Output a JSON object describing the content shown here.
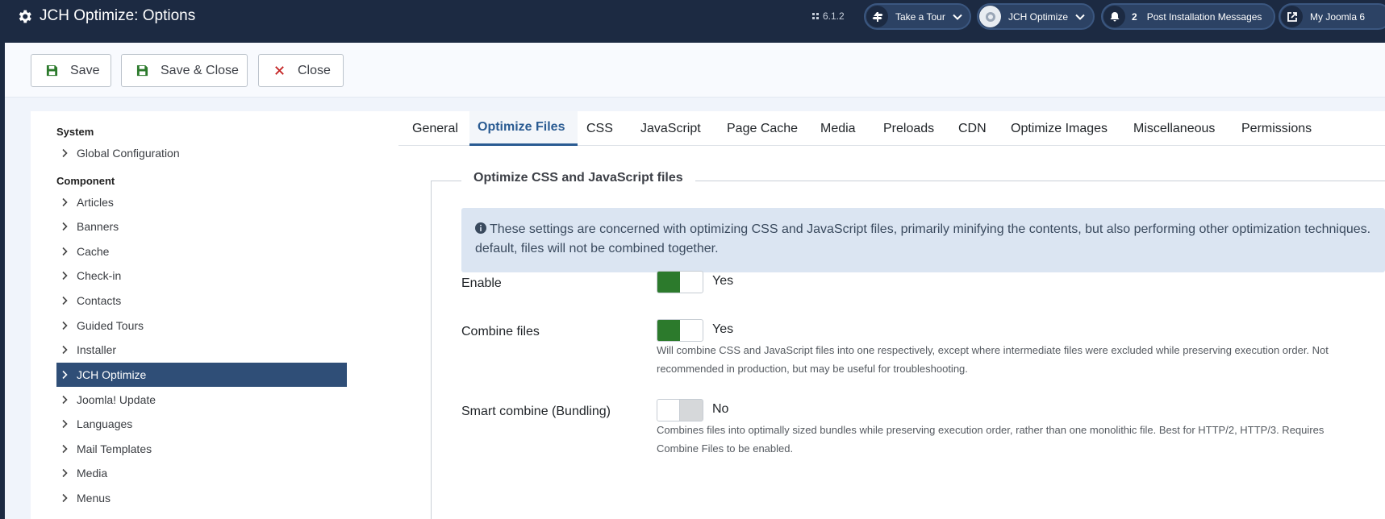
{
  "header": {
    "title": "JCH Optimize: Options",
    "version": "6.1.2",
    "pills": [
      {
        "label": "Take a Tour"
      },
      {
        "label": "JCH Optimize"
      },
      {
        "count": "2",
        "label": "Post Installation Messages"
      },
      {
        "label": "My Joomla 6"
      }
    ]
  },
  "toolbar": {
    "save": "Save",
    "save_close": "Save & Close",
    "close": "Close"
  },
  "sidebar": {
    "sections": [
      {
        "title": "System",
        "items": [
          "Global Configuration"
        ]
      },
      {
        "title": "Component",
        "items": [
          "Articles",
          "Banners",
          "Cache",
          "Check-in",
          "Contacts",
          "Guided Tours",
          "Installer",
          "JCH Optimize",
          "Joomla! Update",
          "Languages",
          "Mail Templates",
          "Media",
          "Menus"
        ]
      }
    ],
    "active": "JCH Optimize"
  },
  "tabs": [
    "General",
    "Optimize Files",
    "CSS",
    "JavaScript",
    "Page Cache",
    "Media",
    "Preloads",
    "CDN",
    "Optimize Images",
    "Miscellaneous",
    "Permissions"
  ],
  "active_tab": "Optimize Files",
  "fieldset": {
    "legend": "Optimize CSS and JavaScript files",
    "alert_line1": "These settings are concerned with optimizing CSS and JavaScript files, primarily minifying the contents, but also performing other optimization techniques. B",
    "alert_line2": "default, files will not be combined together.",
    "fields": [
      {
        "label": "Enable",
        "value": "Yes",
        "on": true
      },
      {
        "label": "Combine files",
        "value": "Yes",
        "on": true,
        "desc1": "Will combine CSS and JavaScript files into one respectively, except where intermediate files were excluded while preserving execution order. Not",
        "desc2": "recommended in production, but may be useful for troubleshooting."
      },
      {
        "label": "Smart combine (Bundling)",
        "value": "No",
        "on": false,
        "desc1": "Combines files into optimally sized bundles while preserving execution order, rather than one monolithic file. Best for HTTP/2, HTTP/3. Requires",
        "desc2": "Combine Files to be enabled."
      }
    ]
  },
  "colors": {
    "header_bg": "#1c2a42",
    "accent": "#2a5b92",
    "active_item": "#2f4e77",
    "switch_on": "#2c7a2c",
    "close_red": "#c52828"
  }
}
